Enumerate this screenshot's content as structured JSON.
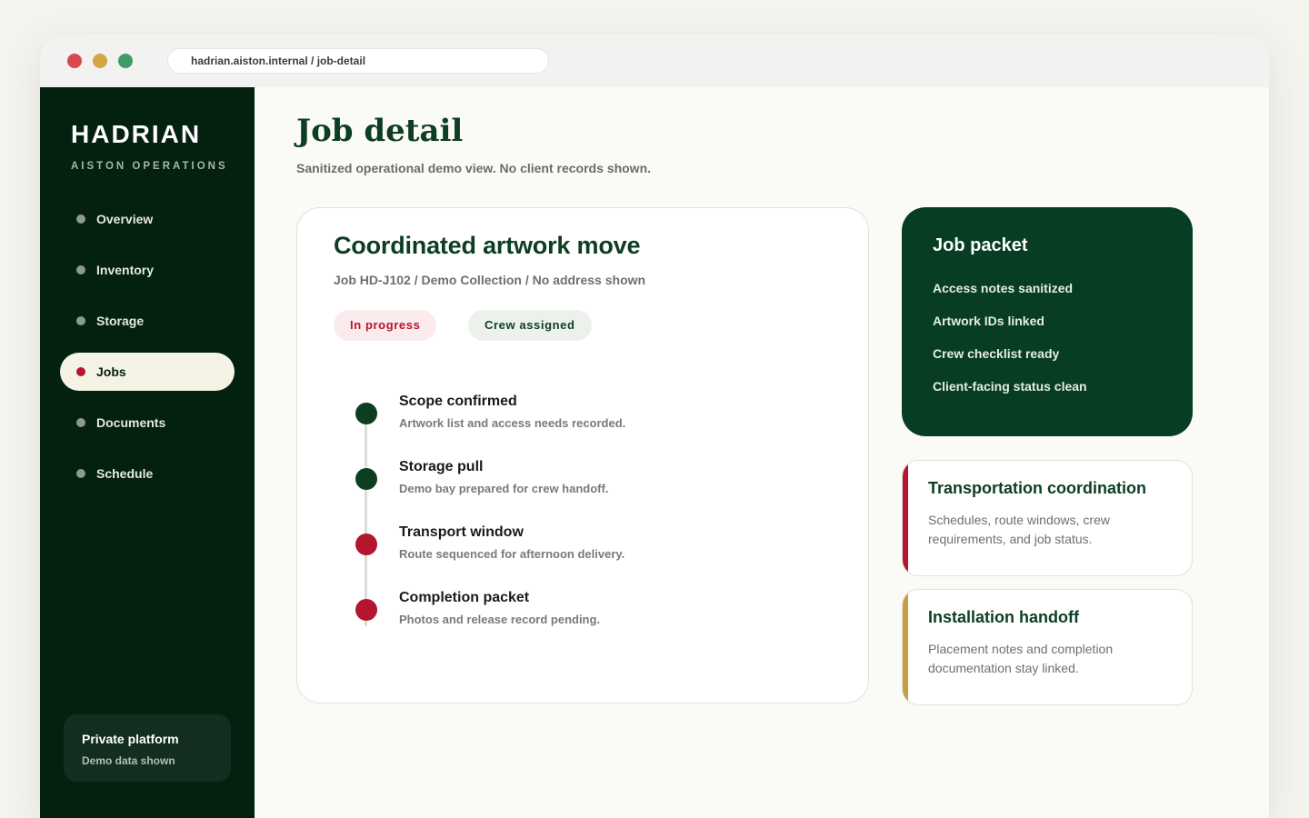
{
  "browser": {
    "url": "hadrian.aiston.internal / job-detail",
    "window_controls": [
      "close",
      "minimize",
      "maximize"
    ]
  },
  "sidebar": {
    "brand": "HADRIAN",
    "brand_sub": "AISTON OPERATIONS",
    "items": [
      {
        "label": "Overview",
        "active": false
      },
      {
        "label": "Inventory",
        "active": false
      },
      {
        "label": "Storage",
        "active": false
      },
      {
        "label": "Jobs",
        "active": true
      },
      {
        "label": "Documents",
        "active": false
      },
      {
        "label": "Schedule",
        "active": false
      }
    ],
    "footer": {
      "title": "Private platform",
      "subtitle": "Demo data shown"
    }
  },
  "main": {
    "title": "Job detail",
    "subtitle": "Sanitized operational demo view. No client records shown.",
    "job": {
      "title": "Coordinated artwork move",
      "meta": "Job HD-J102 / Demo Collection / No address shown",
      "badges": [
        {
          "label": "In progress",
          "color": "#b3162e"
        },
        {
          "label": "Crew assigned",
          "color": "#0d3e22"
        }
      ],
      "timeline": [
        {
          "title": "Scope confirmed",
          "desc": "Artwork list and access needs recorded.",
          "status": "done"
        },
        {
          "title": "Storage pull",
          "desc": "Demo bay prepared for crew handoff.",
          "status": "done"
        },
        {
          "title": "Transport window",
          "desc": "Route sequenced for afternoon delivery.",
          "status": "pending"
        },
        {
          "title": "Completion packet",
          "desc": "Photos and release record pending.",
          "status": "pending"
        }
      ]
    },
    "packet": {
      "title": "Job packet",
      "items": [
        "Access notes sanitized",
        "Artwork IDs linked",
        "Crew checklist ready",
        "Client-facing status clean"
      ]
    },
    "cards": [
      {
        "title": "Transportation coordination",
        "desc": "Schedules, route windows, crew requirements, and job status.",
        "accent": "#b3162e"
      },
      {
        "title": "Installation handoff",
        "desc": "Placement notes and completion documentation stay linked.",
        "accent": "#c99c46"
      }
    ]
  },
  "colors": {
    "brand_green": "#0d3e22",
    "sidebar_bg": "#04200f",
    "accent_red": "#b3162e",
    "accent_gold": "#c99c46"
  }
}
